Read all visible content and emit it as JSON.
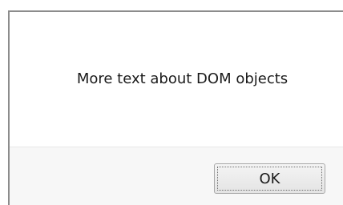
{
  "dialog": {
    "message": "More text about DOM objects",
    "ok_label": "OK"
  }
}
